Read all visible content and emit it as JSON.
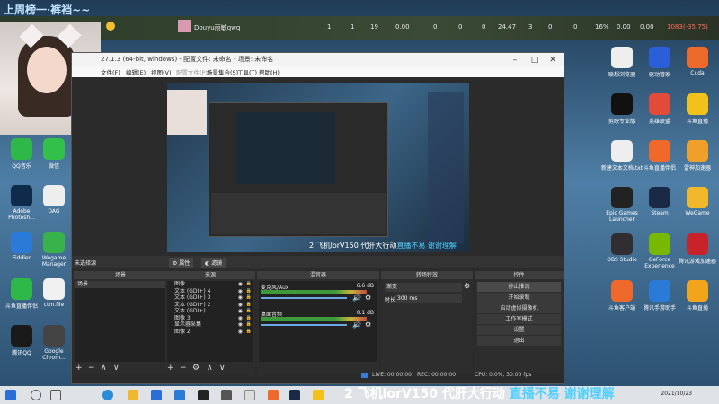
{
  "stream_title": "上周榜一·裤裆~~",
  "topbar": {
    "username": "Douyu丽敏qwq",
    "stats": [
      "1",
      "1",
      "19",
      "0.00",
      "0",
      "0",
      "0",
      "24.47",
      "3",
      "0",
      "0",
      "16%",
      "0.00",
      "0.00",
      "1083(-35.75)"
    ]
  },
  "desktop_left": [
    {
      "label": "QQ音乐",
      "color": "#2fb84a"
    },
    {
      "label": "微信",
      "color": "#33c04a"
    },
    {
      "label": "Adobe Photosh...",
      "color": "#0f2a4a"
    },
    {
      "label": "DAG",
      "color": "#eeeeee"
    },
    {
      "label": "Fiddler",
      "color": "#2a7bd8"
    },
    {
      "label": "Wegame Manager",
      "color": "#38b24a"
    },
    {
      "label": "斗鱼直播伴侣",
      "color": "#2fb84a"
    },
    {
      "label": "ctm.file",
      "color": "#f0f0f0"
    },
    {
      "label": "腾讯QQ",
      "color": "#1a1a1a"
    },
    {
      "label": "Google Chrom...",
      "color": "#444"
    }
  ],
  "desktop_right": [
    {
      "label": "联想浏览器",
      "color": "#eee"
    },
    {
      "label": "驱动管家",
      "color": "#2a5fd8"
    },
    {
      "label": "Cuda",
      "color": "#ee6a2a"
    },
    {
      "label": "剪映专业版",
      "color": "#111"
    },
    {
      "label": "英雄联盟",
      "color": "#e24a3a"
    },
    {
      "label": "斗鱼直播",
      "color": "#f2c21a"
    },
    {
      "label": "新建文本文档.txt",
      "color": "#eee"
    },
    {
      "label": "斗鱼直播伴侣",
      "color": "#ef6a2a"
    },
    {
      "label": "雷神加速器",
      "color": "#f0a02a"
    },
    {
      "label": "Epic Games Launcher",
      "color": "#222"
    },
    {
      "label": "Steam",
      "color": "#1b2a44"
    },
    {
      "label": "WeGame",
      "color": "#f0b82a"
    },
    {
      "label": "OBS Studio",
      "color": "#302e31"
    },
    {
      "label": "GeForce Experience",
      "color": "#76b900"
    },
    {
      "label": "腾讯游戏加速器",
      "color": "#c8232a"
    },
    {
      "label": "斗鱼客户端",
      "color": "#ef6a2a"
    },
    {
      "label": "腾讯手游助手",
      "color": "#2a7bd8"
    },
    {
      "label": "斗鱼直播",
      "color": "#f2a41a"
    }
  ],
  "obs": {
    "title": "27.1.3 (64-bit, windows) - 配置文件: 未命名 - 场景: 未命名",
    "menu": [
      "文件(F)",
      "编辑(E)",
      "视图(V)",
      "配置文件(P)",
      "场景集合(S)",
      "工具(T)",
      "帮助(H)"
    ],
    "no_source": "未选择源",
    "props_button": "属性",
    "filters_button": "滤镜",
    "panels": {
      "scenes": "场景",
      "sources": "来源",
      "mixer": "混音器",
      "transitions": "转场特效",
      "controls": "控件"
    },
    "scenes": [
      "场景"
    ],
    "sources": [
      "图像",
      "文本 (GDI+) 4",
      "文本 (GDI+) 3",
      "文本 (GDI+) 2",
      "文本 (GDI+)",
      "图像 3",
      "显示器采集",
      "图像 2"
    ],
    "mixer": [
      {
        "name": "麦克风/Aux",
        "db": "6.6 dB"
      },
      {
        "name": "桌面音频",
        "db": "0.1 dB"
      }
    ],
    "transitions": {
      "type": "渐变",
      "duration_label": "时长",
      "duration": "300 ms"
    },
    "controls": [
      "停止推流",
      "开始录制",
      "启动虚拟摄像机",
      "工作室模式",
      "设置",
      "退出"
    ],
    "status": {
      "live": "LIVE: 00:00:00",
      "rec": "REC: 00:00:00",
      "cpu": "CPU: 0.0%, 30.00 fps"
    }
  },
  "ticker": {
    "text": "2 飞机lorV150 代肝大行动",
    "text2": "直播不易 谢谢理解"
  },
  "taskbar": {
    "clock": "2021/10/23"
  }
}
